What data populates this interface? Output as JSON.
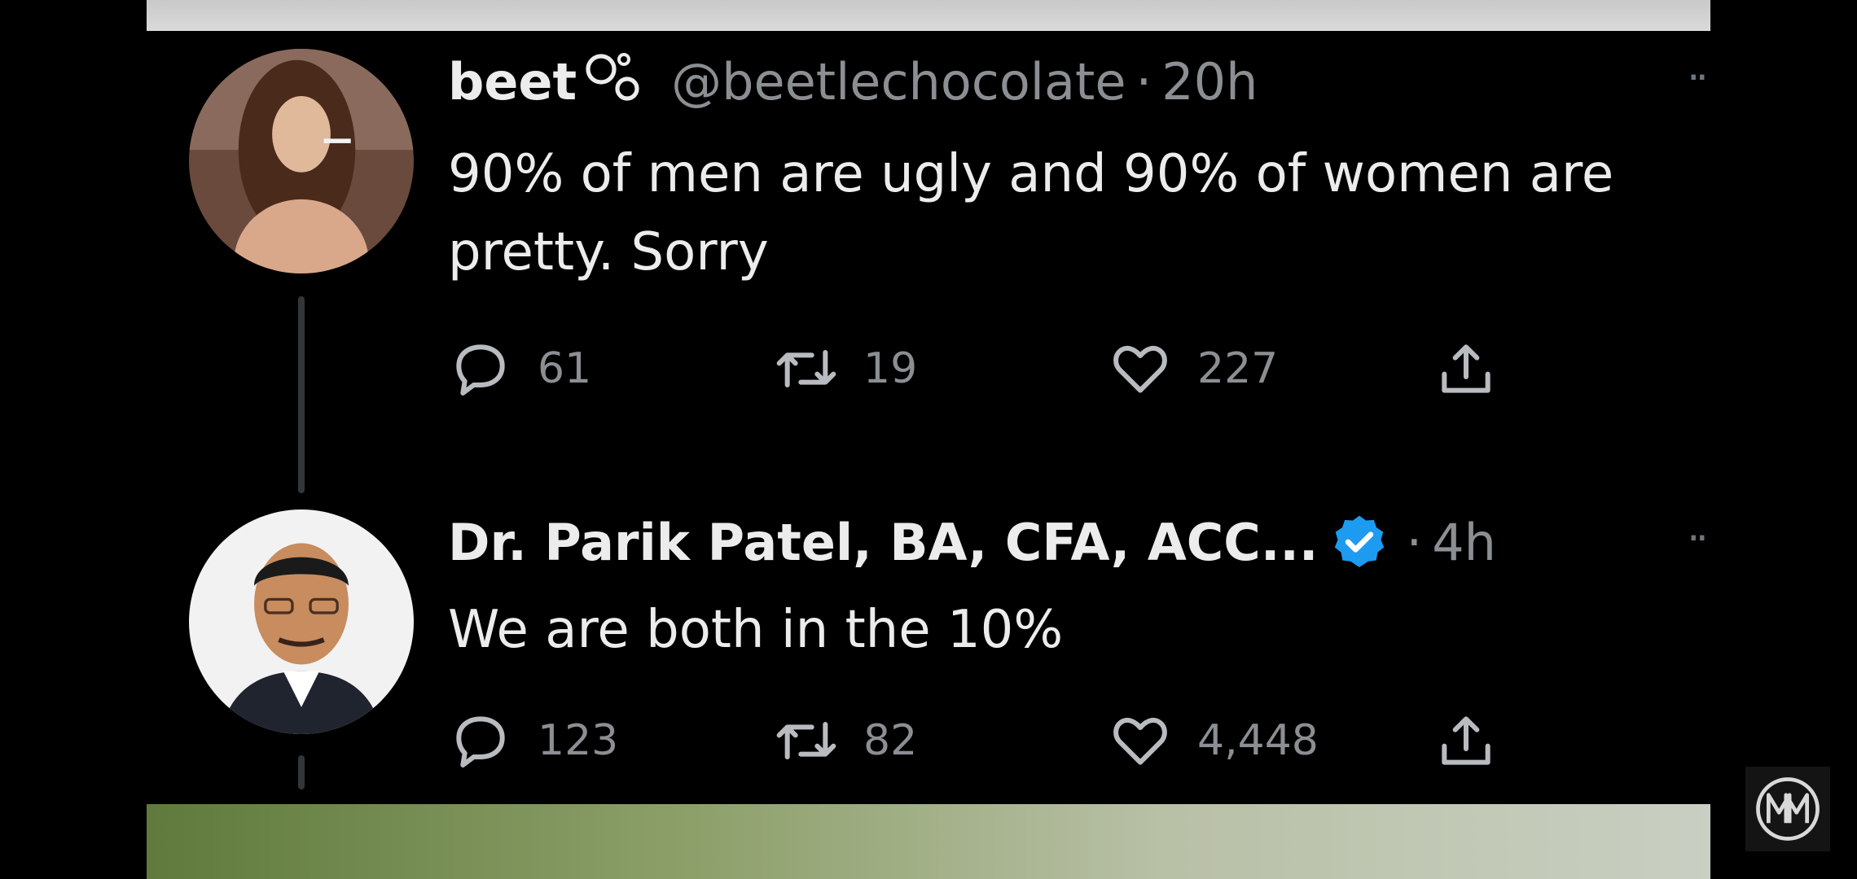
{
  "thread": {
    "tweets": [
      {
        "name": "beet",
        "handle": "@beetlechocolate",
        "separator": "·",
        "time": "20h",
        "text": "90% of men are ugly and 90% of women are pretty. Sorry",
        "replies": "61",
        "retweets": "19",
        "likes": "227",
        "verified": false
      },
      {
        "name": "Dr. Parik Patel, BA, CFA, ACC...",
        "handle": "",
        "separator": "·",
        "time": "4h",
        "text": "We are both in the 10%",
        "replies": "123",
        "retweets": "82",
        "likes": "4,448",
        "verified": true
      }
    ]
  },
  "icons": {
    "more": "more-horizontal-icon",
    "reply": "speech-bubble-icon",
    "retweet": "retweet-arrows-icon",
    "like": "heart-icon",
    "share": "share-upload-icon",
    "verified": "verified-check-icon",
    "name_decoration": "bubble-circles-icon",
    "channel": "mm-logo-icon"
  },
  "colors": {
    "background": "#000000",
    "text": "#e7e9ea",
    "secondary_text": "#8b8f93",
    "verified_blue": "#1d9bf0"
  }
}
